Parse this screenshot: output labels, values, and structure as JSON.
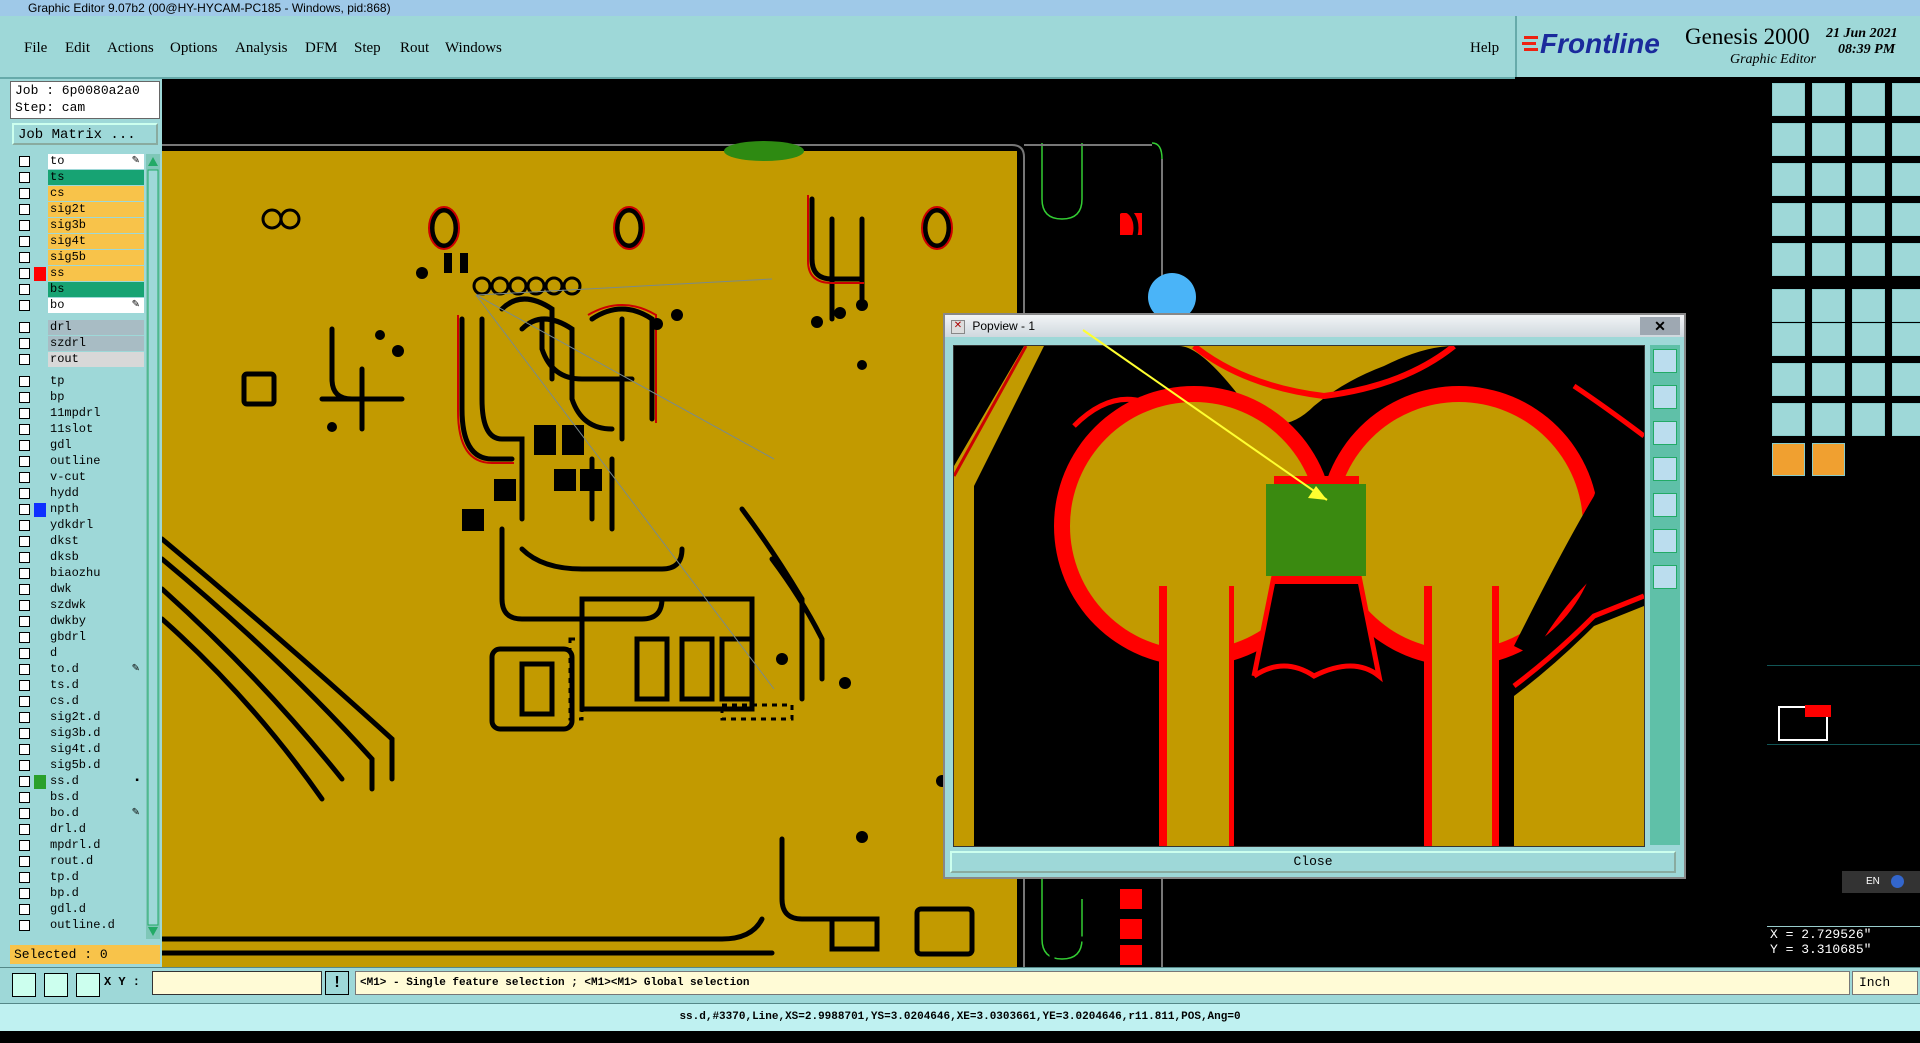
{
  "window": {
    "title": "Graphic Editor 9.07b2 (00@HY-HYCAM-PC185 - Windows, pid:868)"
  },
  "menu": {
    "items": [
      "File",
      "Edit",
      "Actions",
      "Options",
      "Analysis",
      "DFM",
      "Step",
      "Rout",
      "Windows"
    ],
    "help": "Help"
  },
  "brand": {
    "company": "Frontline",
    "product": "Genesis 2000",
    "subtitle": "Graphic Editor",
    "date": "21 Jun 2021",
    "time": "08:39 PM"
  },
  "job": {
    "job_line": "Job : 6p0080a2a0",
    "step_line": "Step: cam",
    "matrix_button": "Job Matrix ..."
  },
  "layers": [
    {
      "name": "to",
      "color": "#ffffff",
      "edit": "✎"
    },
    {
      "name": "ts",
      "color": "#17a373",
      "edit": ""
    },
    {
      "name": "cs",
      "color": "#f8c34a",
      "edit": ""
    },
    {
      "name": "sig2t",
      "color": "#f8c34a",
      "edit": ""
    },
    {
      "name": "sig3b",
      "color": "#f8c34a",
      "edit": ""
    },
    {
      "name": "sig4t",
      "color": "#f8c34a",
      "edit": ""
    },
    {
      "name": "sig5b",
      "color": "#f8c34a",
      "edit": ""
    },
    {
      "name": "ss",
      "color": "#f8c34a",
      "marker": "#ff0000",
      "edit": ""
    },
    {
      "name": "bs",
      "color": "#17a373",
      "edit": ""
    },
    {
      "name": "bo",
      "color": "#ffffff",
      "edit": "✎"
    },
    {
      "sep": true
    },
    {
      "name": "drl",
      "color": "#a8bcc4",
      "edit": ""
    },
    {
      "name": "szdrl",
      "color": "#a8bcc4",
      "edit": ""
    },
    {
      "name": "rout",
      "color": "#d8d8d8",
      "edit": ""
    },
    {
      "sep": true
    },
    {
      "name": "tp",
      "color": "#9ed8d8",
      "edit": ""
    },
    {
      "name": "bp",
      "color": "#9ed8d8",
      "edit": ""
    },
    {
      "name": "11mpdrl",
      "color": "#9ed8d8",
      "edit": ""
    },
    {
      "name": "11slot",
      "color": "#9ed8d8",
      "edit": ""
    },
    {
      "name": "gdl",
      "color": "#9ed8d8",
      "edit": ""
    },
    {
      "name": "outline",
      "color": "#9ed8d8",
      "edit": ""
    },
    {
      "name": "v-cut",
      "color": "#9ed8d8",
      "edit": ""
    },
    {
      "name": "hydd",
      "color": "#9ed8d8",
      "edit": ""
    },
    {
      "name": "npth",
      "color": "#9ed8d8",
      "marker": "#1030ff",
      "edit": ""
    },
    {
      "name": "ydkdrl",
      "color": "#9ed8d8",
      "edit": ""
    },
    {
      "name": "dkst",
      "color": "#9ed8d8",
      "edit": ""
    },
    {
      "name": "dksb",
      "color": "#9ed8d8",
      "edit": ""
    },
    {
      "name": "biaozhu",
      "color": "#9ed8d8",
      "edit": ""
    },
    {
      "name": "dwk",
      "color": "#9ed8d8",
      "edit": ""
    },
    {
      "name": "szdwk",
      "color": "#9ed8d8",
      "edit": ""
    },
    {
      "name": "dwkby",
      "color": "#9ed8d8",
      "edit": ""
    },
    {
      "name": "gbdrl",
      "color": "#9ed8d8",
      "edit": ""
    },
    {
      "name": "d",
      "color": "#9ed8d8",
      "edit": ""
    },
    {
      "name": "to.d",
      "color": "#9ed8d8",
      "edit": "✎"
    },
    {
      "name": "ts.d",
      "color": "#9ed8d8",
      "edit": ""
    },
    {
      "name": "cs.d",
      "color": "#9ed8d8",
      "edit": ""
    },
    {
      "name": "sig2t.d",
      "color": "#9ed8d8",
      "edit": ""
    },
    {
      "name": "sig3b.d",
      "color": "#9ed8d8",
      "edit": ""
    },
    {
      "name": "sig4t.d",
      "color": "#9ed8d8",
      "edit": ""
    },
    {
      "name": "sig5b.d",
      "color": "#9ed8d8",
      "edit": ""
    },
    {
      "name": "ss.d",
      "color": "#9ed8d8",
      "marker": "#2aa02a",
      "edit": "▪"
    },
    {
      "name": "bs.d",
      "color": "#9ed8d8",
      "edit": ""
    },
    {
      "name": "bo.d",
      "color": "#9ed8d8",
      "edit": "✎"
    },
    {
      "name": "drl.d",
      "color": "#9ed8d8",
      "edit": ""
    },
    {
      "name": "mpdrl.d",
      "color": "#9ed8d8",
      "edit": ""
    },
    {
      "name": "rout.d",
      "color": "#9ed8d8",
      "edit": ""
    },
    {
      "name": "tp.d",
      "color": "#9ed8d8",
      "edit": ""
    },
    {
      "name": "bp.d",
      "color": "#9ed8d8",
      "edit": ""
    },
    {
      "name": "gdl.d",
      "color": "#9ed8d8",
      "edit": ""
    },
    {
      "name": "outline.d",
      "color": "#9ed8d8",
      "edit": ""
    }
  ],
  "selected": "Selected : 0",
  "popup": {
    "title": "Popview - 1",
    "close_x": "✕",
    "close_button": "Close"
  },
  "bottom": {
    "xy_label": "X Y :",
    "xy_value": "",
    "hint": "<M1> - Single feature selection ; <M1><M1> Global selection",
    "units": "Inch",
    "status": "ss.d,#3370,Line,XS=2.9988701,YS=3.0204646,XE=3.0303661,YE=3.0204646,r11.811,POS,Ang=0"
  },
  "coords": {
    "x": "X = 2.729526\"",
    "y": "Y = 3.310685\""
  },
  "lang": "EN",
  "colors": {
    "copper": "#c29a00",
    "highlight": "#ff0000",
    "selected_feature": "#3a8a10",
    "panel": "#9ed8d8"
  }
}
